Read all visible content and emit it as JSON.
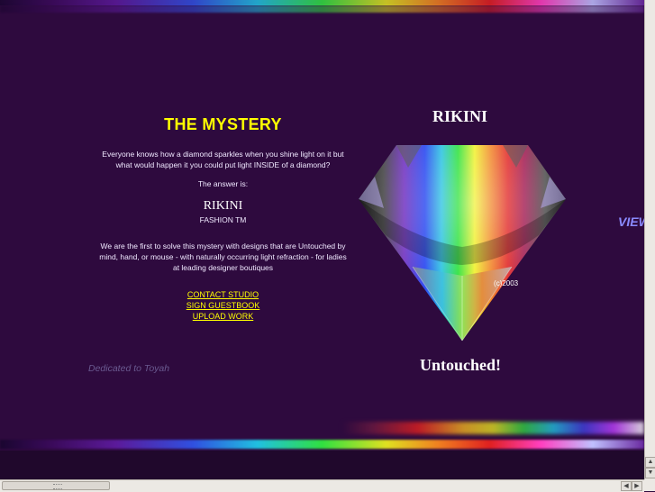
{
  "left_column": {
    "title": "THE MYSTERY",
    "paragraph1": "Everyone knows how a diamond sparkles when you shine light on it but what would happen it you could put light INSIDE of a diamond?",
    "answer": "The answer is:",
    "brand": "RIKINI",
    "brand_tm": "FASHION TM",
    "paragraph2": "We are the first to solve this mystery with designs that are Untouched by mind, hand, or mouse - with naturally occurring light refraction - for ladies at leading designer boutiques",
    "links": [
      "CONTACT STUDIO",
      "SIGN GUESTBOOK",
      "UPLOAD WORK"
    ],
    "dedication": "Dedicated to Toyah"
  },
  "right_column": {
    "brand": "RIKINI",
    "copyright": "(c)2003",
    "tagline": "Untouched!",
    "view_text": "VIEW"
  },
  "colors": {
    "background": "#2e0a3e",
    "title": "#ffff00",
    "link": "#ffff00",
    "dedication": "#6a5a90",
    "view_text": "#8a8aff"
  },
  "icons": {
    "scroll_up": "arrow-up-icon",
    "scroll_down": "arrow-down-icon",
    "scroll_left": "arrow-left-icon",
    "scroll_right": "arrow-right-icon"
  }
}
